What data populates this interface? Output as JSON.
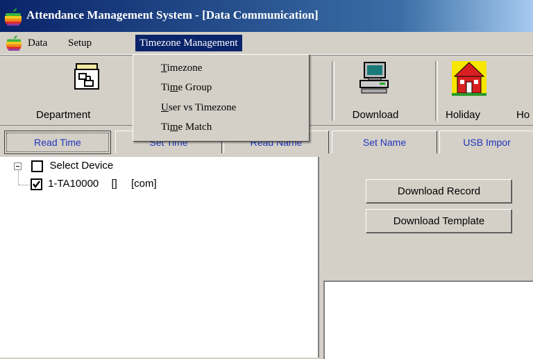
{
  "window": {
    "title": "Attendance Management System - [Data Communication]"
  },
  "menubar": {
    "items": [
      {
        "label": "Data"
      },
      {
        "label": "Setup"
      },
      {
        "label": "Timezone Management"
      }
    ]
  },
  "dropdown": {
    "items": [
      {
        "pre": "",
        "u": "T",
        "post": "imezone"
      },
      {
        "pre": "Ti",
        "u": "m",
        "post": "e Group"
      },
      {
        "pre": "",
        "u": "U",
        "post": "ser vs Timezone"
      },
      {
        "pre": "Ti",
        "u": "m",
        "post": "e Match"
      }
    ]
  },
  "toolbar": {
    "items": [
      {
        "label": "Department",
        "icon": "department-icon"
      },
      {
        "label": "Download",
        "icon": "computer-icon"
      },
      {
        "label": "Holiday",
        "icon": "school-house-icon"
      },
      {
        "label": "Ho",
        "icon": ""
      }
    ]
  },
  "tabs": [
    {
      "label": "Read Time",
      "selected": true
    },
    {
      "label": "Set Time"
    },
    {
      "label": "Read Name"
    },
    {
      "label": "Set Name"
    },
    {
      "label": "USB Impor"
    }
  ],
  "tree": {
    "root": {
      "label": "Select Device",
      "checked": false
    },
    "children": [
      {
        "name": "1-TA10000",
        "extra": "[]",
        "conn": "[com]",
        "checked": true
      }
    ]
  },
  "buttons": {
    "download_record": "Download Record",
    "download_template": "Download Template"
  },
  "colors": {
    "title_bar": "#0a246a",
    "menu_highlight": "#0a246a",
    "tab_text": "#1f33b8",
    "face": "#d4d0c8"
  }
}
